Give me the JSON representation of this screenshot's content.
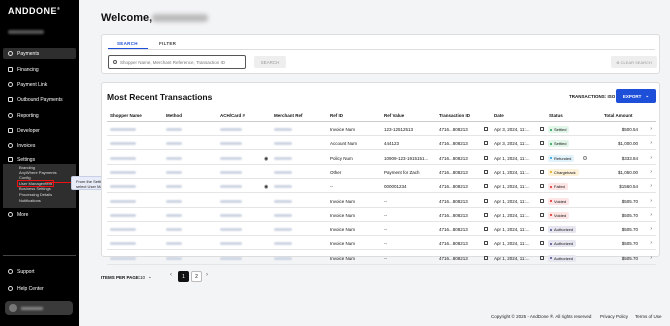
{
  "brand": {
    "logo": "ANDDONE",
    "logo_mark": "®",
    "account_name": "ACCOUNT NAME"
  },
  "sidebar": {
    "items": [
      {
        "label": "Payments",
        "icon": "dollar-icon"
      },
      {
        "label": "Financing",
        "icon": "card-icon"
      },
      {
        "label": "Payment Link",
        "icon": "link-icon"
      },
      {
        "label": "Outbound Payments",
        "icon": "outbound-icon"
      },
      {
        "label": "Reporting",
        "icon": "chart-icon"
      },
      {
        "label": "Developer",
        "icon": "code-icon"
      },
      {
        "label": "Invoices",
        "icon": "invoice-icon"
      },
      {
        "label": "Settings",
        "icon": "gear-icon"
      },
      {
        "label": "More",
        "icon": "more-icon"
      }
    ],
    "settings_sub": [
      "Branding",
      "AnyWhere Payments Config",
      "User Management",
      "Business Settings",
      "Processing Details",
      "Notifications"
    ],
    "bottom": [
      {
        "label": "Support",
        "icon": "help-icon"
      },
      {
        "label": "Help Center",
        "icon": "book-icon"
      }
    ],
    "user_name": "Thiago Souza"
  },
  "callout": "From the Settings drop-down menu select User Management.",
  "welcome": {
    "greeting": "Welcome,",
    "name": "Thiago Souza"
  },
  "search": {
    "tabs": [
      "SEARCH",
      "FILTER"
    ],
    "placeholder": "Shopper Name, Merchant Reference, Transaction ID",
    "search_button": "SEARCH",
    "clear_button": "CLEAR SEARCH"
  },
  "transactions": {
    "title": "Most Recent Transactions",
    "id_label": "TRANSACTIONS: ISO",
    "export_label": "EXPORT",
    "columns": [
      "Shopper Name",
      "Method",
      "ACH/Card #",
      "Merchant Ref",
      "Ref ID",
      "Ref Value",
      "Transaction ID",
      "Date",
      "Status",
      "Total Amount"
    ],
    "rows": [
      {
        "ref_id": "Invoice Num",
        "ref_value": "123-12512513",
        "tx_id": "4716...808213",
        "date": "Apr 3, 2024, 11:...",
        "status": "Settled",
        "amount": "$500.54",
        "eye": false,
        "info": false
      },
      {
        "ref_id": "Account Num",
        "ref_value": "444123",
        "tx_id": "4716...808213",
        "date": "Apr 3, 2024, 11:...",
        "status": "Settled",
        "amount": "$1,000.00",
        "eye": false,
        "info": false
      },
      {
        "ref_id": "Policy Num",
        "ref_value": "10909-123-1915151...",
        "tx_id": "4716...808213",
        "date": "Apr 1, 2024, 11:...",
        "status": "Refunded",
        "amount": "$333.84",
        "eye": true,
        "info": true
      },
      {
        "ref_id": "Other",
        "ref_value": "Payment for Zach",
        "tx_id": "4716...808213",
        "date": "Apr 1, 2024, 11:...",
        "status": "Chargeback",
        "amount": "$1,050.00",
        "eye": false,
        "info": false
      },
      {
        "ref_id": "--",
        "ref_value": "000001234",
        "tx_id": "4716...808213",
        "date": "Apr 1, 2024, 11:...",
        "status": "Failed",
        "amount": "$1560.54",
        "eye": true,
        "info": false
      },
      {
        "ref_id": "Invoice Num",
        "ref_value": "--",
        "tx_id": "4716...808213",
        "date": "Apr 1, 2024, 11:...",
        "status": "Voided",
        "amount": "$505.70",
        "eye": false,
        "info": false
      },
      {
        "ref_id": "Invoice Num",
        "ref_value": "--",
        "tx_id": "4716...808213",
        "date": "Apr 1, 2024, 11:...",
        "status": "Voided",
        "amount": "$505.70",
        "eye": false,
        "info": false
      },
      {
        "ref_id": "Invoice Num",
        "ref_value": "--",
        "tx_id": "4716...808213",
        "date": "Apr 1, 2024, 11:...",
        "status": "Authorized",
        "amount": "$505.70",
        "eye": false,
        "info": false
      },
      {
        "ref_id": "Invoice Num",
        "ref_value": "--",
        "tx_id": "4716...808213",
        "date": "Apr 1, 2024, 11:...",
        "status": "Authorized",
        "amount": "$505.70",
        "eye": false,
        "info": false
      },
      {
        "ref_id": "Invoice Num",
        "ref_value": "--",
        "tx_id": "4716...808213",
        "date": "Apr 1, 2024, 11:...",
        "status": "Authorized",
        "amount": "$505.70",
        "eye": false,
        "info": false
      }
    ]
  },
  "status_colors": {
    "Settled": {
      "bg": "#e2f6ea",
      "dot": "#1a9b4b"
    },
    "Refunded": {
      "bg": "#e3f3fb",
      "dot": "#1a9bd8"
    },
    "Chargeback": {
      "bg": "#fdf1d8",
      "dot": "#e2a012"
    },
    "Failed": {
      "bg": "#fde5e5",
      "dot": "#e02424"
    },
    "Voided": {
      "bg": "#fde5e5",
      "dot": "#e02424"
    },
    "Authorized": {
      "bg": "#e6e6f0",
      "dot": "#4a4a8a"
    }
  },
  "pagination": {
    "label": "ITEMS PER PAGE:",
    "per_page": "10",
    "pages": [
      "1",
      "2"
    ],
    "current": "1"
  },
  "footer": {
    "copyright": "Copyright © 2025 - AndDone ®. All rights reserved",
    "privacy": "Privacy Policy",
    "terms": "Terms of Use"
  },
  "colors": {
    "accent": "#1e4fd8",
    "sidebar_bg": "#000000",
    "page_bg": "#f3f4f6"
  }
}
